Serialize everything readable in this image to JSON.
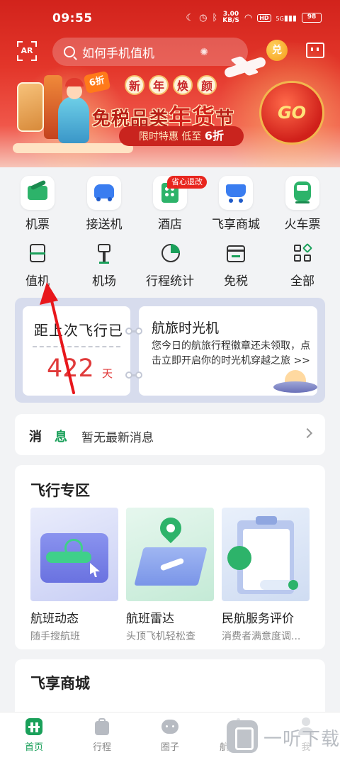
{
  "status": {
    "time": "09:55",
    "speed_top": "3.00",
    "speed_unit": "KB/S",
    "hd": "HD",
    "net": "5G",
    "battery": "98"
  },
  "header": {
    "ar_label": "AR",
    "search_placeholder": "如何手机值机",
    "coin_label": "兑"
  },
  "banner": {
    "tag": "6折",
    "top_chars": [
      "新",
      "年",
      "焕",
      "颜"
    ],
    "main_a": "免税品类",
    "main_b": "年货",
    "main_c": "节",
    "sub_a": "限时特惠  低至",
    "sub_b": "6折",
    "lantern_text": "GO"
  },
  "services_row1": [
    {
      "label": "机票",
      "icon": "flight-ticket-icon"
    },
    {
      "label": "接送机",
      "icon": "car-icon"
    },
    {
      "label": "酒店",
      "icon": "hotel-icon"
    },
    {
      "label": "飞享商城",
      "icon": "shopping-cart-icon"
    },
    {
      "label": "火车票",
      "icon": "train-icon"
    }
  ],
  "hotel_badge": "省心退改",
  "services_row2": [
    {
      "label": "值机",
      "icon": "check-in-icon"
    },
    {
      "label": "机场",
      "icon": "airport-icon"
    },
    {
      "label": "行程统计",
      "icon": "pie-chart-icon"
    },
    {
      "label": "免税",
      "icon": "duty-free-icon"
    },
    {
      "label": "全部",
      "icon": "grid-icon"
    }
  ],
  "flight_card": {
    "since_label": "距上次飞行已",
    "days": "422",
    "days_unit": "天",
    "machine_title": "航旅时光机",
    "machine_desc": "您今日的航旅行程徽章还未领取，点击立即开启你的时光机穿越之旅 >>"
  },
  "messages": {
    "label_a": "消",
    "label_b": "息",
    "text": "暂无最新消息"
  },
  "flight_zone": {
    "title": "飞行专区",
    "cards": [
      {
        "name": "航班动态",
        "sub": "随手搜航班"
      },
      {
        "name": "航班雷达",
        "sub": "头顶飞机轻松查"
      },
      {
        "name": "民航服务评价",
        "sub": "消费者满意度调..."
      }
    ]
  },
  "shop": {
    "title": "飞享商城"
  },
  "nav": [
    {
      "label": "首页",
      "icon": "home-icon",
      "active": true
    },
    {
      "label": "行程",
      "icon": "luggage-icon",
      "active": false
    },
    {
      "label": "圈子",
      "icon": "community-icon",
      "active": false
    },
    {
      "label": "航班动态",
      "icon": "flight-status-icon",
      "active": false
    },
    {
      "label": "我",
      "icon": "profile-icon",
      "active": false
    }
  ],
  "watermark": "一听下载",
  "colors": {
    "brand_red": "#d2231c",
    "brand_green": "#1aa05a",
    "accent_red": "#e03a3a",
    "annotation_arrow": "#e8171c"
  }
}
